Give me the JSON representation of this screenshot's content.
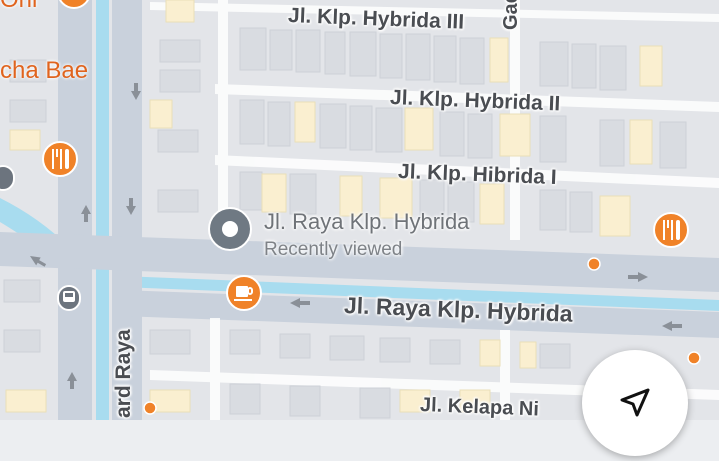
{
  "colors": {
    "background": "#eceef1",
    "block": "#e4e6ea",
    "building": "#dadde2",
    "building_yellow": "#faefd0",
    "road": "#ffffff",
    "road_major": "#c9d1dc",
    "water": "#a8dcef",
    "poi_orange": "#f08228",
    "place_marker": "#6f7983",
    "transit": "#6c747e"
  },
  "streets": {
    "hybrida_iii": "Jl. Klp. Hybrida III",
    "hybrida_ii": "Jl. Klp. Hybrida II",
    "hibrida_i": "Jl. Klp. Hibrida I",
    "raya_hybrida": "Jl. Raya Klp. Hybrida",
    "gading": "Gadin",
    "boulevard": "ard Raya",
    "kelapa": "Jl. Kelapa Ni"
  },
  "places": {
    "restaurant_name": "cha Bae",
    "top_left_partial": "Oni",
    "selected_place": {
      "title": "Jl. Raya Klp. Hybrida",
      "subtitle": "Recently viewed"
    }
  },
  "icons": {
    "restaurant": "fork-knife-icon",
    "cafe": "coffee-cup-icon",
    "bus": "bus-icon",
    "place": "place-marker-icon",
    "arrow": "one-way-arrow-icon",
    "navigate": "navigation-arrow-icon"
  }
}
